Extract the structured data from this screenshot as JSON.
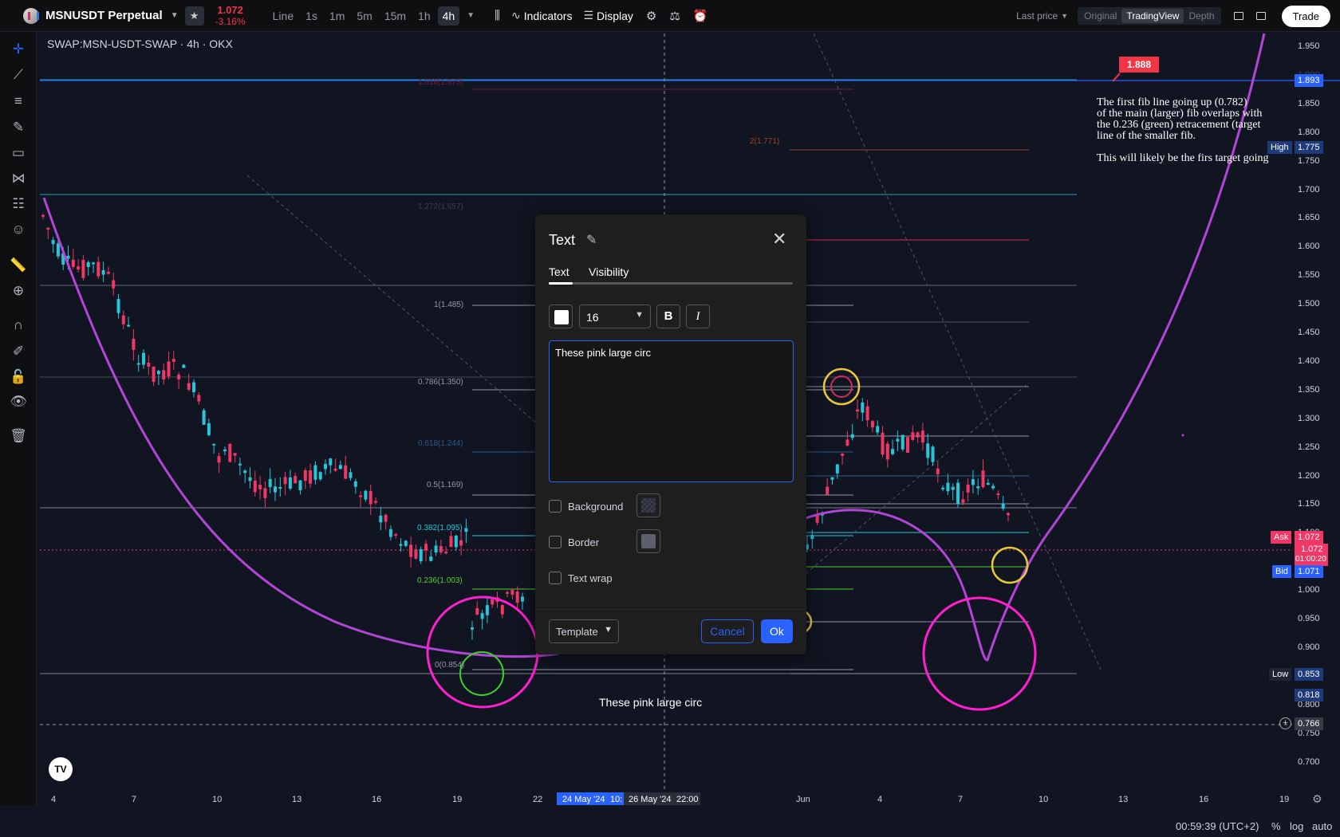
{
  "header": {
    "symbol": "MSNUSDT Perpetual",
    "price": "1.072",
    "change": "-3.16%",
    "timeframes": [
      "Line",
      "1s",
      "1m",
      "5m",
      "15m",
      "1h",
      "4h"
    ],
    "active_timeframe": "4h",
    "indicators_label": "Indicators",
    "display_label": "Display",
    "last_price_label": "Last price",
    "views": [
      "Original",
      "TradingView",
      "Depth"
    ],
    "active_view": "TradingView",
    "trade_label": "Trade"
  },
  "chart_legend": "SWAP:MSN-USDT-SWAP · 4h · OKX",
  "annotation_text": "The first fib line going up (0.782)\nof the main (larger) fib overlaps with\nthe 0.236 (green) retracement (target\nline of the smaller fib.\n\nThis will likely be the firs target going",
  "placed_text": "These pink large circ",
  "fib_labels": {
    "l1618": "1.618(1.873)",
    "l2": "2(1.771)",
    "l1272": "1.272(1.657)",
    "l1": "1(1.485)",
    "l786": "0.786(1.350)",
    "l618": "0.618(1.244)",
    "l5": "0.5(1.169)",
    "l382": "0.382(1.095)",
    "l236": "0.236(1.003)",
    "l0": "0(0.854)"
  },
  "price_axis": {
    "ticks": [
      "1.950",
      "1.900",
      "1.850",
      "1.800",
      "1.750",
      "1.700",
      "1.650",
      "1.600",
      "1.550",
      "1.500",
      "1.450",
      "1.400",
      "1.350",
      "1.300",
      "1.250",
      "1.200",
      "1.150",
      "1.100",
      "1.050",
      "1.000",
      "0.950",
      "0.900",
      "0.850",
      "0.800",
      "0.750",
      "0.700"
    ],
    "tag_1888": "1.888",
    "tag_1893": "1.893",
    "high_label": "High",
    "high_value": "1.775",
    "ask_label": "Ask",
    "ask_value": "1.072",
    "last_value": "1.072",
    "countdown": "01:00:20",
    "bid_label": "Bid",
    "bid_value": "1.071",
    "low_label": "Low",
    "low_value": "0.853",
    "tag_0818": "0.818",
    "crosshair_value": "0.766"
  },
  "time_axis": {
    "ticks": [
      "4",
      "7",
      "10",
      "13",
      "16",
      "19",
      "22",
      "Jun",
      "4",
      "7",
      "10",
      "13",
      "16",
      "19"
    ],
    "highlight_a": "24 May '24",
    "highlight_a_time": "10:",
    "highlight_b": "26 May '24",
    "highlight_b_time": "22:00"
  },
  "status_bar": {
    "clock": "00:59:39 (UTC+2)",
    "percent": "%",
    "log": "log",
    "auto": "auto"
  },
  "dialog": {
    "title": "Text",
    "tabs": [
      "Text",
      "Visibility"
    ],
    "font_size": "16",
    "bold_label": "B",
    "italic_label": "I",
    "text_value": "These pink large circ",
    "background_label": "Background",
    "border_label": "Border",
    "text_wrap_label": "Text wrap",
    "template_label": "Template",
    "cancel_label": "Cancel",
    "ok_label": "Ok"
  },
  "colors": {
    "up": "#26c6da",
    "down": "#f23665",
    "accent": "#2962ff",
    "pink_circle": "#ff1fd1",
    "curve": "#b145d6"
  }
}
